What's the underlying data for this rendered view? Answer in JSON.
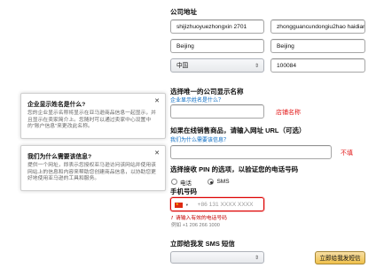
{
  "address": {
    "title": "公司地址",
    "line1": "shijizhuoyuezhongxin 2701",
    "line2": "zhongguancundongiu2hao haidian",
    "city": "Beijing",
    "state": "Beijing",
    "country": "中国",
    "postal": "100084"
  },
  "display_name": {
    "title": "选择唯一的公司显示名称",
    "link": "企业显示姓名是什么？",
    "value": "",
    "annotation": "店铺名称"
  },
  "website": {
    "title": "如果在线销售商品，请输入网址 URL（可选）",
    "link": "我们为什么需要该信息？",
    "value": "",
    "annotation": "不填"
  },
  "pin": {
    "title": "选择接收 PIN 的选项，以验证您的电话号码",
    "option1": "电话",
    "option2": "SMS",
    "selected": "SMS"
  },
  "phone": {
    "label": "手机号码",
    "placeholder": "+86 131 XXXX XXXX",
    "error": "请输入有效的电话号码",
    "example": "例如 +1 206 266 1000",
    "flag_color": "#de2910"
  },
  "sms": {
    "title": "立即给我发 SMS 短信",
    "button": "立即给我发短信"
  },
  "tooltips": [
    {
      "title": "企业显示姓名是什么?",
      "body": "您的企业显示名称将显示在亚马逊商品信息一起显示，并且显示在卖家简介上。您随时可以通过卖家中心设置中的\"账户信息\"来更改此名称。"
    },
    {
      "title": "我们为什么需要该信息?",
      "body": "提供一个网址，即表示您授权亚马逊访问该网站并使用该网站上的信息和内容来帮助您创建商品信息，以协助您更好地使用亚马逊的工具和服务。"
    }
  ]
}
